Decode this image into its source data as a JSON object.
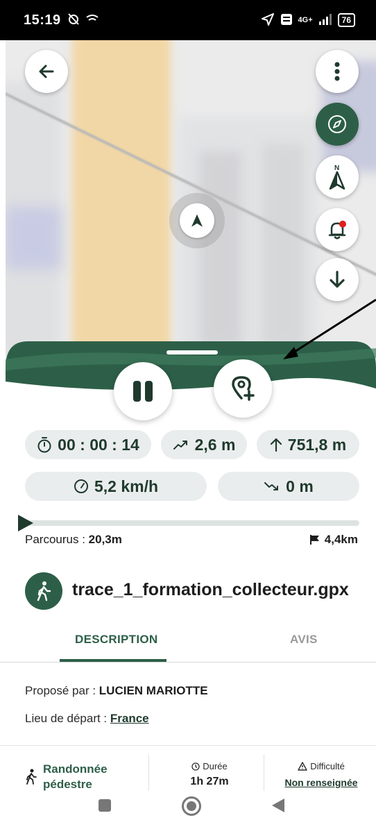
{
  "status_bar": {
    "time": "15:19",
    "signal_label": "4G+",
    "battery": "76"
  },
  "stats": {
    "elapsed": "00 : 00 : 14",
    "elevation_gain": "2,6 m",
    "altitude": "751,8 m",
    "speed": "5,2 km/h",
    "elevation_loss": "0 m"
  },
  "progress": {
    "traveled_label": "Parcourus : ",
    "traveled_value": "20,3m",
    "remaining": "4,4km",
    "fraction": 0.005
  },
  "trace": {
    "title": "trace_1_formation_collecteur.gpx"
  },
  "tabs": {
    "description": "DESCRIPTION",
    "reviews": "AVIS"
  },
  "details": {
    "proposed_label": "Proposé par : ",
    "proposed_value": "LUCIEN MARIOTTE",
    "start_label": "Lieu de départ : ",
    "start_value": "France"
  },
  "summary": {
    "activity_line1": "Randonnée",
    "activity_line2": "pédestre",
    "duration_label": "Durée",
    "duration_value": "1h 27m",
    "difficulty_label": "Difficulté",
    "difficulty_value": "Non renseignée"
  },
  "colors": {
    "primary": "#2d5f48",
    "wave_light": "#3f7a5c",
    "chip_bg": "#eaeded"
  },
  "icons": {
    "back": "arrow-left-icon",
    "menu": "more-vertical-icon",
    "compass": "compass-icon",
    "north": "north-arrow-icon",
    "alert": "bell-alert-icon",
    "download": "arrow-down-icon",
    "pause": "pause-icon",
    "add_poi": "add-location-icon",
    "hiker": "hiker-icon"
  }
}
